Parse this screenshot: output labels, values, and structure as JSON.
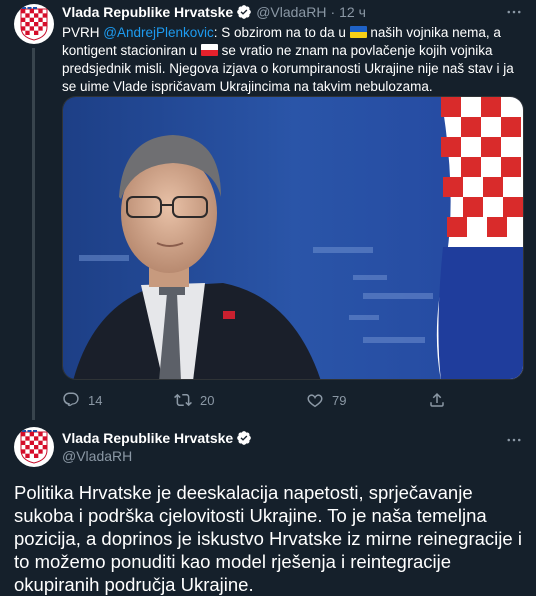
{
  "tweet1": {
    "author_name": "Vlada Republike Hrvatske",
    "author_handle": "@VladaRH",
    "time": "12 ч",
    "text_part1": "PVRH ",
    "mention": "@AndrejPlenkovic",
    "text_part2": ": S obzirom na to da u ",
    "text_part3": " naših vojnika nema, a kontigent stacioniran u ",
    "text_part4": " se vratio ne znam na povlačenje kojih vojnika predsjednik misli. Njegova izjava o korumpiranosti Ukrajine nije naš stav i ja se uime Vlade ispričavam Ukrajincima na takvim nebulozama.",
    "flag1": "flag-ukraine",
    "flag2": "flag-poland",
    "replies": "14",
    "retweets": "20",
    "likes": "79"
  },
  "tweet2": {
    "author_name": "Vlada Republike Hrvatske",
    "author_handle": "@VladaRH",
    "text": "Politika Hrvatske je deeskalacija napetosti, sprječavanje sukoba i podrška cjelovitosti Ukrajine. To je naša temeljna pozicija, a doprinos je iskustvo Hrvatske iz mirne reinegracije i to možemo ponuditi kao model rješenja i reintegracije okupiranih područja Ukrajine."
  },
  "icons": {
    "verified": "verified-badge-icon",
    "more": "more-icon",
    "reply": "reply-icon",
    "retweet": "retweet-icon",
    "like": "heart-icon",
    "share": "share-icon",
    "avatar": "croatian-coat-of-arms"
  },
  "colors": {
    "background": "#15202b",
    "text": "#ffffff",
    "secondary": "#8b98a5",
    "link": "#1d9bf0",
    "divider": "#38444d"
  }
}
